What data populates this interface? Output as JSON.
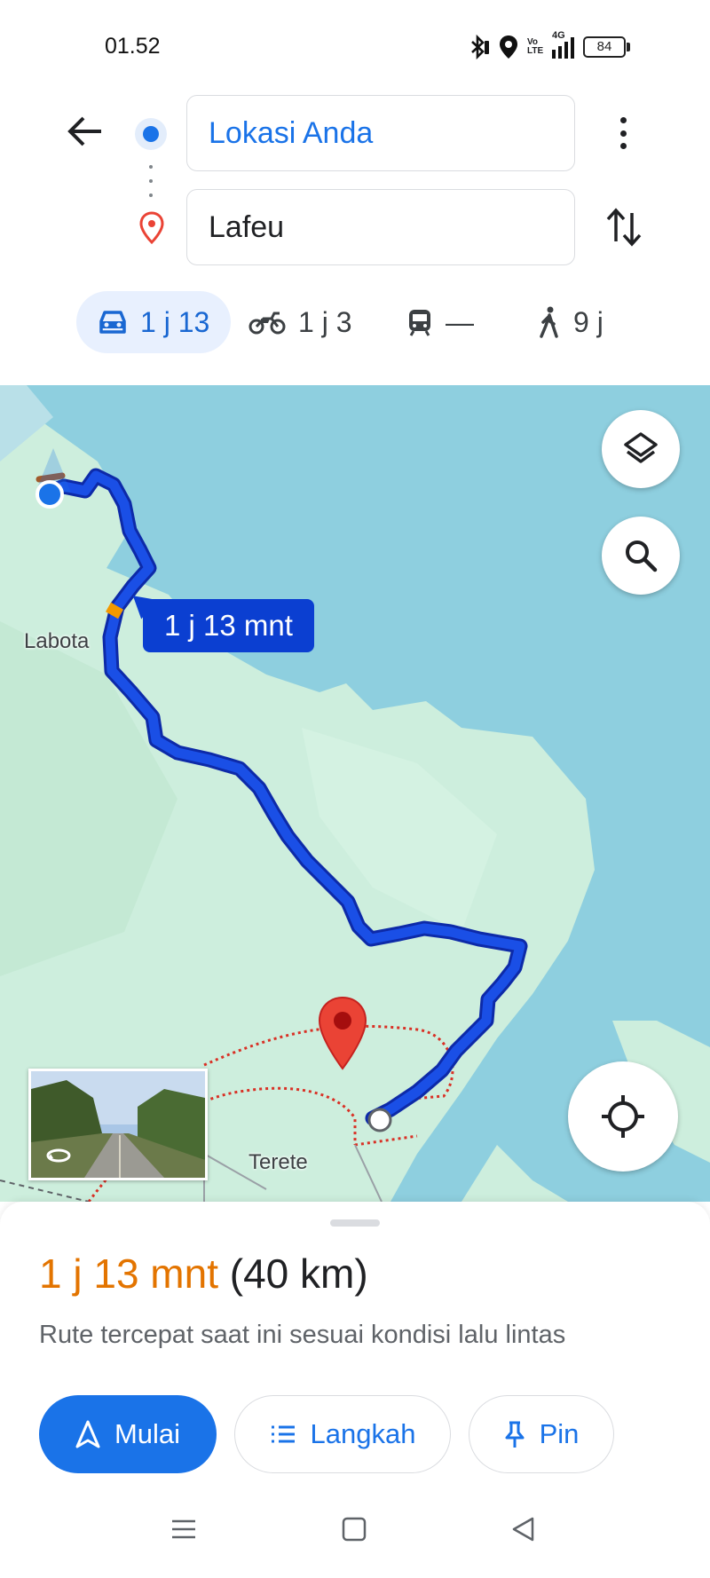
{
  "status_bar": {
    "time": "01.52",
    "battery": "84",
    "network": "4G",
    "volte": "Vo LTE",
    "icons": [
      "bluetooth-icon",
      "location-icon",
      "volte-icon",
      "signal-icon",
      "battery-icon"
    ]
  },
  "directions": {
    "origin": "Lokasi Anda",
    "destination": "Lafeu"
  },
  "modes": [
    {
      "name": "car",
      "label": "1 j 13",
      "active": true
    },
    {
      "name": "motorbike",
      "label": "1 j 3",
      "active": false
    },
    {
      "name": "transit",
      "label": "—",
      "active": false
    },
    {
      "name": "walk",
      "label": "9 j",
      "active": false
    }
  ],
  "map": {
    "eta_label": "1 j 13 mnt",
    "places": [
      "Labota",
      "Terete"
    ],
    "colors": {
      "water": "#8ecfdf",
      "land": "#cdeedd",
      "route": "#1a4fe6",
      "pin": "#ea4335"
    }
  },
  "summary": {
    "duration": "1 j 13 mnt",
    "distance": "(40 km)",
    "description": "Rute tercepat saat ini sesuai kondisi lalu lintas"
  },
  "actions": {
    "start": "Mulai",
    "steps": "Langkah",
    "pin": "Pin"
  },
  "accent_color": "#1a73e8"
}
